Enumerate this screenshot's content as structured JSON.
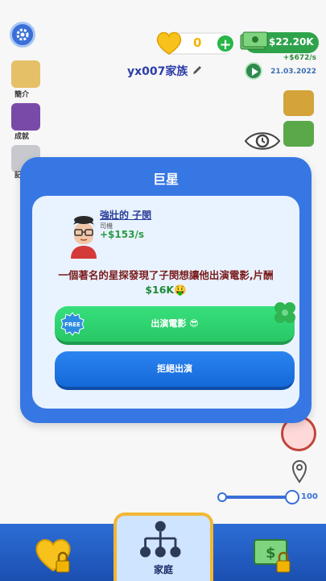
{
  "hud": {
    "hearts": "0",
    "money": "$22.20K",
    "rate": "+$672/s",
    "date": "21.03.2022",
    "family_name": "yx007家族"
  },
  "sidebar": {
    "items": [
      {
        "label": "簡介",
        "icon": "scroll-icon"
      },
      {
        "label": "成就",
        "icon": "book-icon"
      },
      {
        "label": "記錄",
        "icon": "folder-icon"
      }
    ]
  },
  "zoom": {
    "value": "100"
  },
  "bottom_nav": {
    "left_icon": "locked-heart-icon",
    "center_label": "家庭",
    "right_icon": "locked-money-icon"
  },
  "modal": {
    "title": "巨星",
    "character": {
      "name": "強壯的 子閔",
      "role": "司機",
      "income": "+$153/s"
    },
    "message_prefix": "一個著名的星探發現了子閔想讓他出演電影,片酬",
    "amount": "$16K",
    "amount_emoji": "🤑",
    "accept": {
      "label": "出演電影",
      "emoji": "😎",
      "badge": "FREE"
    },
    "reject": {
      "label": "拒絕出演"
    }
  },
  "colors": {
    "modal_blue": "#3777e3",
    "accept_green": "#2bc96a",
    "reject_blue": "#1d75e4"
  }
}
